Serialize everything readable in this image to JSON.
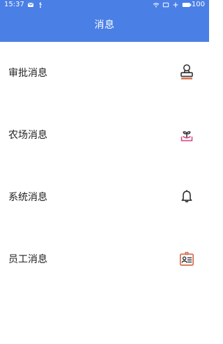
{
  "status_bar": {
    "time": "15:37",
    "battery": "100",
    "icons": [
      "message-icon",
      "usb-icon",
      "wifi-icon",
      "screen-icon",
      "plus-icon",
      "battery-icon"
    ]
  },
  "header": {
    "title": "消息"
  },
  "items": [
    {
      "label": "审批消息",
      "icon": "stamp-icon",
      "accent": "#d76b4a"
    },
    {
      "label": "农场消息",
      "icon": "seedling-icon",
      "accent": "#d84a88"
    },
    {
      "label": "系统消息",
      "icon": "bell-icon",
      "accent": "#333333"
    },
    {
      "label": "员工消息",
      "icon": "id-card-icon",
      "accent": "#d76b4a"
    }
  ],
  "colors": {
    "header_bg": "#4a7fe6",
    "text": "#222222",
    "background": "#ffffff"
  }
}
